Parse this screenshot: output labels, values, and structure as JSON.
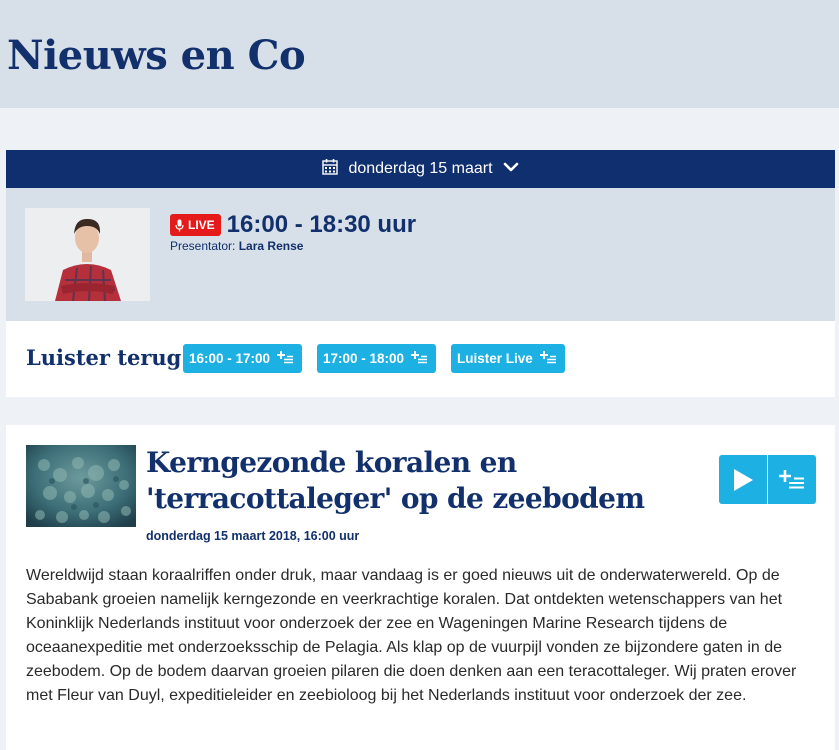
{
  "header": {
    "title": "Nieuws en Co"
  },
  "date_bar": {
    "label": "donderdag 15 maart",
    "icons": [
      "calendar-icon",
      "chevron-down-icon"
    ]
  },
  "show": {
    "live_label": "LIVE",
    "time": "16:00 - 18:30 uur",
    "presenter_label": "Presentator:",
    "presenter_name": "Lara Rense"
  },
  "listen_back": {
    "title": "Luister terug",
    "buttons": [
      {
        "label": "16:00 - 17:00"
      },
      {
        "label": "17:00 - 18:00"
      },
      {
        "label": "Luister Live"
      }
    ]
  },
  "article": {
    "title": "Kerngezonde koralen en 'terracottaleger' op de zeebodem",
    "date": "donderdag 15 maart 2018, 16:00 uur",
    "body": "Wereldwijd staan koraalriffen onder druk, maar vandaag is er goed nieuws uit de onderwaterwereld. Op de Sababank groeien namelijk kerngezonde en veerkrachtige koralen. Dat ontdekten wetenschappers van het Koninklijk Nederlands instituut voor onderzoek der zee en Wageningen Marine Research tijdens de oceaanexpeditie met onderzoeksschip de Pelagia. Als klap op de vuurpijl vonden ze bijzondere gaten in de zeebodem. Op de bodem daarvan groeien pilaren die doen denken aan een teracottaleger. Wij praten erover met Fleur van Duyl, expeditieleider en zeebioloog bij het Nederlands instituut voor onderzoek der zee."
  },
  "colors": {
    "navy": "#0f2f6e",
    "accent": "#1db0e3",
    "live": "#e51a1a",
    "panel": "#d7dfe9"
  }
}
